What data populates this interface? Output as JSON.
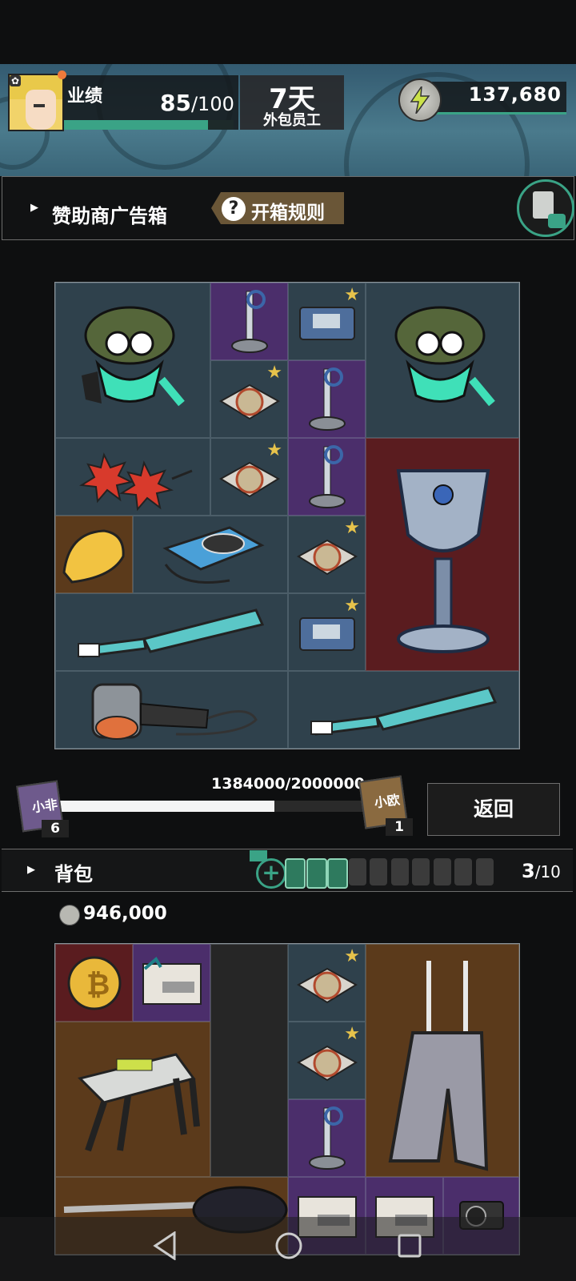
{
  "header": {
    "performance_label": "业绩",
    "performance_value": "85",
    "performance_max": "/100",
    "performance_fraction": 0.85,
    "days": "7天",
    "role": "外包员工",
    "energy": "137,680"
  },
  "box_section": {
    "title": "赞助商广告箱",
    "rules_label": "开箱规则"
  },
  "progress": {
    "text": "1384000/2000000",
    "current": 1384000,
    "max": 2000000,
    "left_card_glyph": "小非",
    "left_count": "6",
    "right_card_glyph": "小欧",
    "right_count": "1",
    "return_label": "返回"
  },
  "backpack": {
    "title": "背包",
    "add_icon": "+",
    "batteries_filled": 3,
    "batteries_total": 10,
    "count": "3",
    "count_max": "/10",
    "coins": "946,000"
  },
  "icons": {
    "rules": "question-mark-icon",
    "energy": "lightning-icon",
    "clipboard": "clipboard-search-icon"
  },
  "colors": {
    "accent": "#3aa386",
    "star": "#e7c34b",
    "cell_purple": "#4b2e6b",
    "cell_red": "#5a1c1f",
    "cell_brown": "#5b3a1b",
    "cell_slate": "#2f414c"
  }
}
